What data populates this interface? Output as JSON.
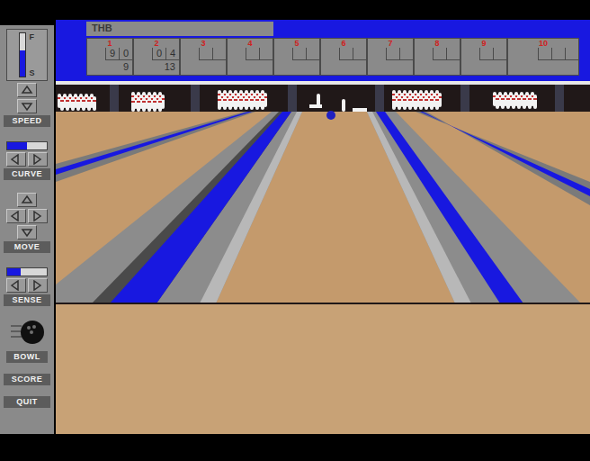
{
  "player": {
    "name": "THB"
  },
  "controls": {
    "speed": {
      "label": "SPEED",
      "max_label": "F",
      "min_label": "S",
      "level": 0.6
    },
    "curve": {
      "label": "CURVE",
      "level": 0.5
    },
    "move": {
      "label": "MOVE"
    },
    "sense": {
      "label": "SENSE",
      "level": 0.35
    },
    "buttons": [
      {
        "label": "BOWL"
      },
      {
        "label": "SCORE"
      },
      {
        "label": "QUIT"
      }
    ]
  },
  "frames": [
    {
      "number": "1",
      "rolls": [
        "9",
        "0"
      ],
      "total": "9"
    },
    {
      "number": "2",
      "rolls": [
        "0",
        "4"
      ],
      "total": "13"
    },
    {
      "number": "3",
      "rolls": [
        "",
        ""
      ],
      "total": ""
    },
    {
      "number": "4",
      "rolls": [
        "",
        ""
      ],
      "total": ""
    },
    {
      "number": "5",
      "rolls": [
        "",
        ""
      ],
      "total": ""
    },
    {
      "number": "6",
      "rolls": [
        "",
        ""
      ],
      "total": ""
    },
    {
      "number": "7",
      "rolls": [
        "",
        ""
      ],
      "total": ""
    },
    {
      "number": "8",
      "rolls": [
        "",
        ""
      ],
      "total": ""
    },
    {
      "number": "9",
      "rolls": [
        "",
        ""
      ],
      "total": ""
    },
    {
      "number": "10",
      "rolls": [
        "",
        "",
        ""
      ],
      "total": ""
    }
  ]
}
